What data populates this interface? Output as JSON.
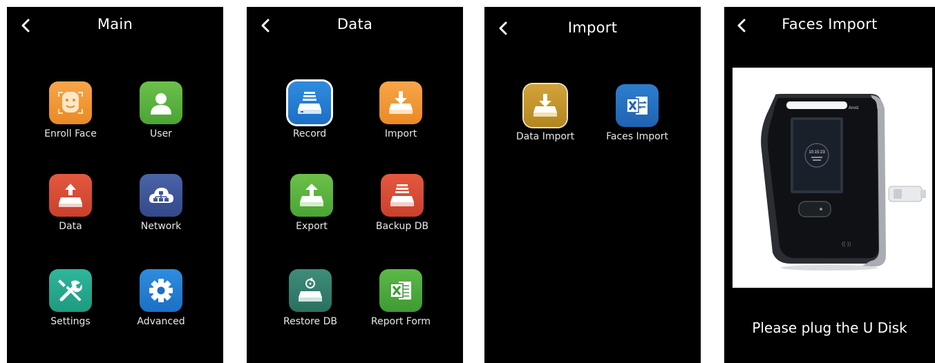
{
  "screens": {
    "main": {
      "title": "Main",
      "items": [
        {
          "label": "Enroll Face",
          "icon": "face-icon"
        },
        {
          "label": "User",
          "icon": "user-icon"
        },
        {
          "label": "Data",
          "icon": "data-icon"
        },
        {
          "label": "Network",
          "icon": "network-cloud-icon"
        },
        {
          "label": "Settings",
          "icon": "wrench-screwdriver-icon"
        },
        {
          "label": "Advanced",
          "icon": "gear-icon"
        }
      ]
    },
    "data": {
      "title": "Data",
      "items": [
        {
          "label": "Record",
          "icon": "record-icon"
        },
        {
          "label": "Import",
          "icon": "import-icon"
        },
        {
          "label": "Export",
          "icon": "export-icon"
        },
        {
          "label": "Backup DB",
          "icon": "backup-db-icon"
        },
        {
          "label": "Restore DB",
          "icon": "restore-db-icon"
        },
        {
          "label": "Report Form",
          "icon": "excel-icon"
        }
      ]
    },
    "import": {
      "title": "Import",
      "items": [
        {
          "label": "Data Import",
          "icon": "data-import-icon"
        },
        {
          "label": "Faces Import",
          "icon": "excel-import-icon"
        }
      ]
    },
    "faces_import": {
      "title": "Faces Import",
      "device_brand": "Anviz",
      "device_time": "10:15:23",
      "message": "Please plug the U Disk"
    }
  },
  "colors": {
    "background": "#000000",
    "text": "#ffffff",
    "orange": "#f39a35",
    "green": "#5bb23f",
    "red": "#d84d35",
    "navy": "#3f5699",
    "teal": "#26a88d",
    "blue": "#2580d3",
    "gold": "#c39529"
  }
}
